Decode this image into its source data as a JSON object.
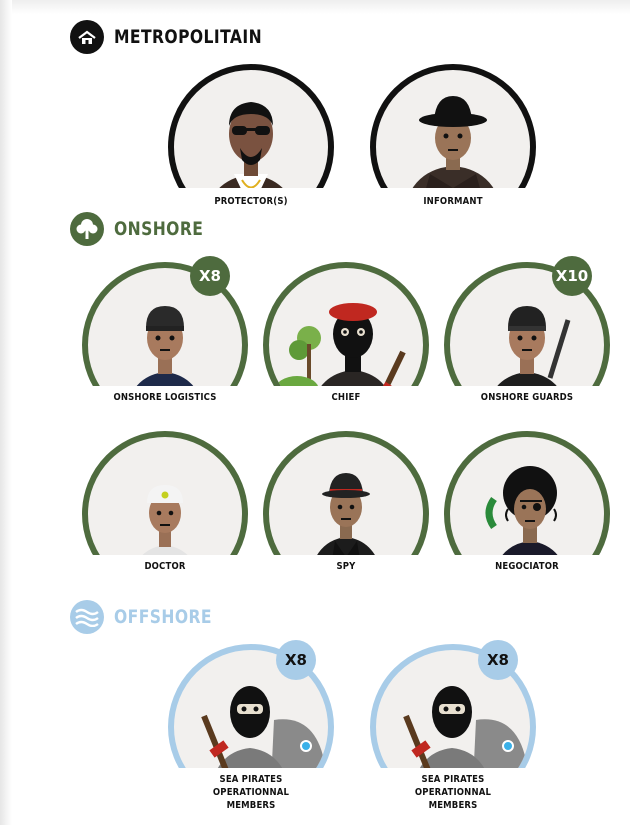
{
  "sections": {
    "metropolitain": {
      "title": "METROPOLITAIN",
      "icon": "house-icon",
      "color": "#111111",
      "members": [
        {
          "label": "PROTECTOR(S)"
        },
        {
          "label": "INFORMANT"
        }
      ]
    },
    "onshore": {
      "title": "ONSHORE",
      "icon": "tree-icon",
      "color": "#4e6b3e",
      "members": [
        {
          "label": "ONSHORE LOGISTICS",
          "count": "X8"
        },
        {
          "label": "CHIEF"
        },
        {
          "label": "ONSHORE GUARDS",
          "count": "X10"
        },
        {
          "label": "DOCTOR"
        },
        {
          "label": "SPY"
        },
        {
          "label": "NEGOCIATOR"
        }
      ]
    },
    "offshore": {
      "title": "OFFSHORE",
      "icon": "waves-icon",
      "color": "#a8cce8",
      "members": [
        {
          "label": "SEA PIRATES\nOPERATIONNAL\nMEMBERS",
          "count": "X8"
        },
        {
          "label": "SEA PIRATES\nOPERATIONNAL\nMEMBERS",
          "count": "X8"
        }
      ]
    }
  }
}
